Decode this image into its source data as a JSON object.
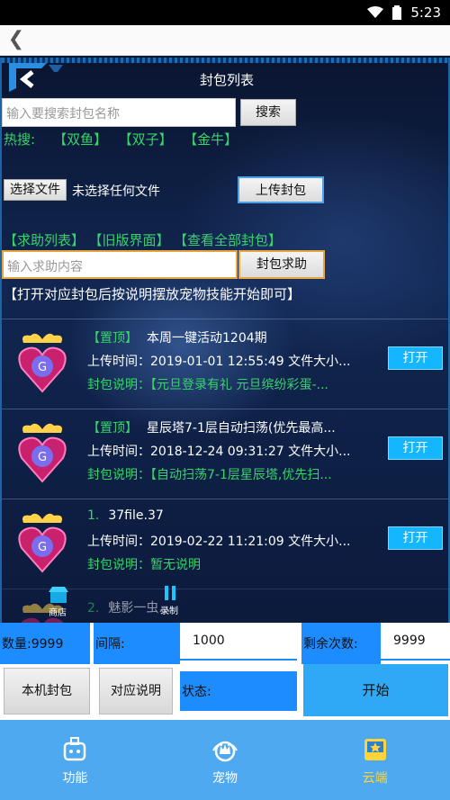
{
  "status_bar": {
    "time": "5:23"
  },
  "page": {
    "title": "封包列表"
  },
  "search": {
    "placeholder": "输入要搜索封包名称",
    "button": "搜索"
  },
  "hot_search": {
    "label": "热搜:",
    "items": [
      "【双鱼】",
      "【双子】",
      "【金牛】"
    ]
  },
  "file_upload": {
    "choose_label": "选择文件",
    "status": "未选择任何文件",
    "upload_label": "上传封包"
  },
  "links": [
    "【求助列表】",
    "【旧版界面】",
    "【查看全部封包】"
  ],
  "help": {
    "placeholder": "输入求助内容",
    "button": "封包求助"
  },
  "notice": "【打开对应封包后按说明摆放宠物技能开始即可】",
  "packages": [
    {
      "tag": "【置顶】",
      "name": "本周一键活动1204期",
      "upload": "上传时间：2019-01-01 12:55:49 文件大小...",
      "desc": "封包说明：【元旦登录有礼 元旦缤纷彩蛋-...",
      "open": "打开"
    },
    {
      "tag": "【置顶】",
      "name": "星辰塔7-1层自动扫荡(优先最高...",
      "upload": "上传时间：2018-12-24 09:31:27 文件大小...",
      "desc": "封包说明：【自动扫荡7-1层星辰塔,优先扫...",
      "open": "打开"
    },
    {
      "tag": "1.",
      "name": "37file.37",
      "upload": "上传时间：2019-02-22 11:21:09 文件大小...",
      "desc": "封包说明：暂无说明",
      "open": "打开"
    },
    {
      "tag": "2.",
      "name": "魅影一虫..."
    }
  ],
  "overlay": {
    "store_label": "商店",
    "pause_label": "录制"
  },
  "controls": {
    "count_label": "数量:9999",
    "interval_label": "间隔:",
    "interval_value": "1000",
    "remaining_label": "剩余次数:",
    "remaining_value": "9999",
    "local_button": "本机封包",
    "guide_button": "对应说明",
    "status_label": "状态:",
    "start_button": "开始"
  },
  "tabs": [
    {
      "label": "功能",
      "icon": "robot-icon"
    },
    {
      "label": "宠物",
      "icon": "pet-crown-icon"
    },
    {
      "label": "云端",
      "icon": "cloud-star-icon",
      "active": true
    }
  ],
  "colors": {
    "accent_green": "#37d46a",
    "open_button": "#14b6ff",
    "tab_bar": "#4fa9f0",
    "active_tab": "#ffd43a"
  }
}
